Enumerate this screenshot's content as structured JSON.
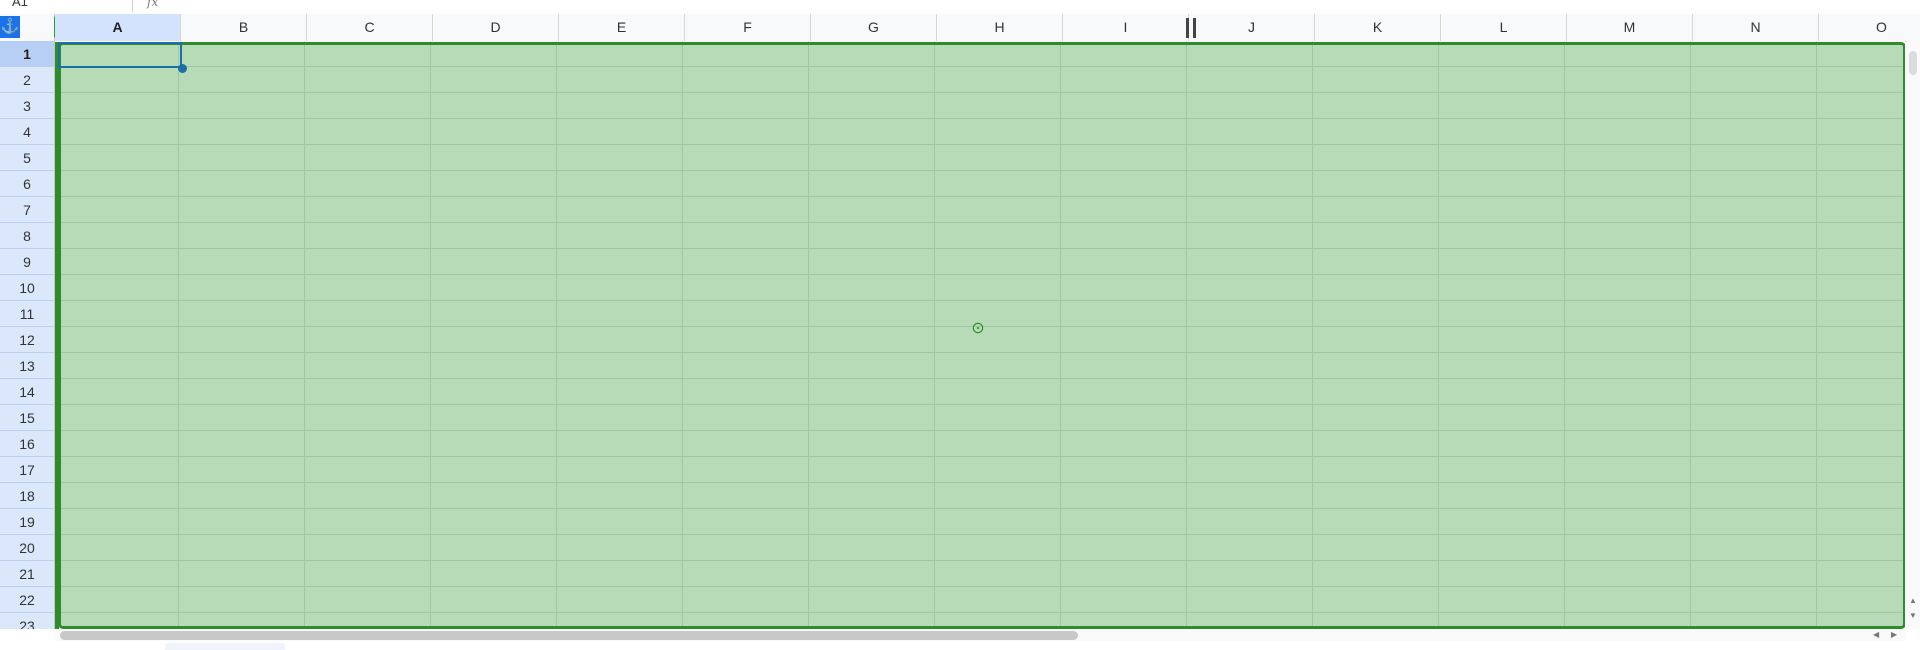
{
  "formula_bar": {
    "name_box": "A1",
    "fx_label": "fx"
  },
  "header": {
    "anchor_icon": "anchor-icon",
    "target_icon": "target-icon",
    "columns": [
      "A",
      "B",
      "C",
      "D",
      "E",
      "F",
      "G",
      "H",
      "I",
      "J",
      "K",
      "L",
      "M",
      "N",
      "O"
    ],
    "active_column": "A"
  },
  "rows": [
    "1",
    "2",
    "3",
    "4",
    "5",
    "6",
    "7",
    "8",
    "9",
    "10",
    "11",
    "12",
    "13",
    "14",
    "15",
    "16",
    "17",
    "18",
    "19",
    "20",
    "21",
    "22",
    "23"
  ],
  "active_row": "1",
  "selection": {
    "range": "whole sheet",
    "fill_color": "#5aaa5a",
    "border_color": "#2e8b2e"
  },
  "active_cell": {
    "ref": "A1",
    "value": ""
  },
  "icons": {
    "center_icon": "crosshair-icon"
  },
  "scroll": {
    "up_arrow": "▲",
    "down_arrow": "▼",
    "left_arrow": "◀",
    "right_arrow": "▶"
  }
}
